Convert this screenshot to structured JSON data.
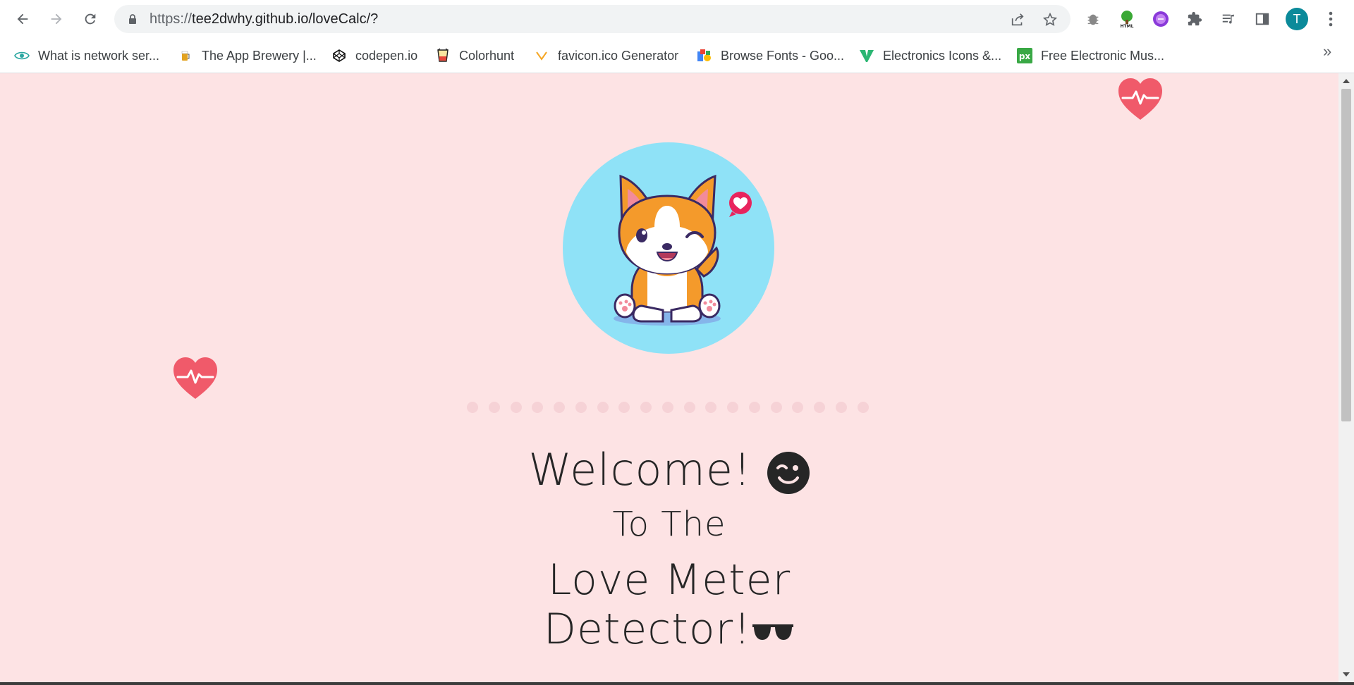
{
  "browser": {
    "url_scheme": "https://",
    "url_rest": "tee2dwhy.github.io/loveCalc/?",
    "profile_initial": "T",
    "bookmarks": [
      {
        "label": "What is network ser...",
        "icon": "eye-icon"
      },
      {
        "label": "The App Brewery |...",
        "icon": "beer-icon"
      },
      {
        "label": "codepen.io",
        "icon": "codepen-icon"
      },
      {
        "label": "Colorhunt",
        "icon": "colorhunt-icon"
      },
      {
        "label": "favicon.ico Generator",
        "icon": "favicon-icon"
      },
      {
        "label": "Browse Fonts - Goo...",
        "icon": "google-fonts-icon"
      },
      {
        "label": "Electronics Icons &...",
        "icon": "vecteezy-icon"
      },
      {
        "label": "Free Electronic Mus...",
        "icon": "px-icon"
      }
    ],
    "bookmarks_more": "»"
  },
  "page": {
    "welcome": "Welcome!",
    "to_the": "To The",
    "love_meter": "Love Meter",
    "detector": "Detector!",
    "accent_color": "#f05a6a",
    "background_color": "#fde3e4",
    "circle_color": "#8fe2f7"
  }
}
